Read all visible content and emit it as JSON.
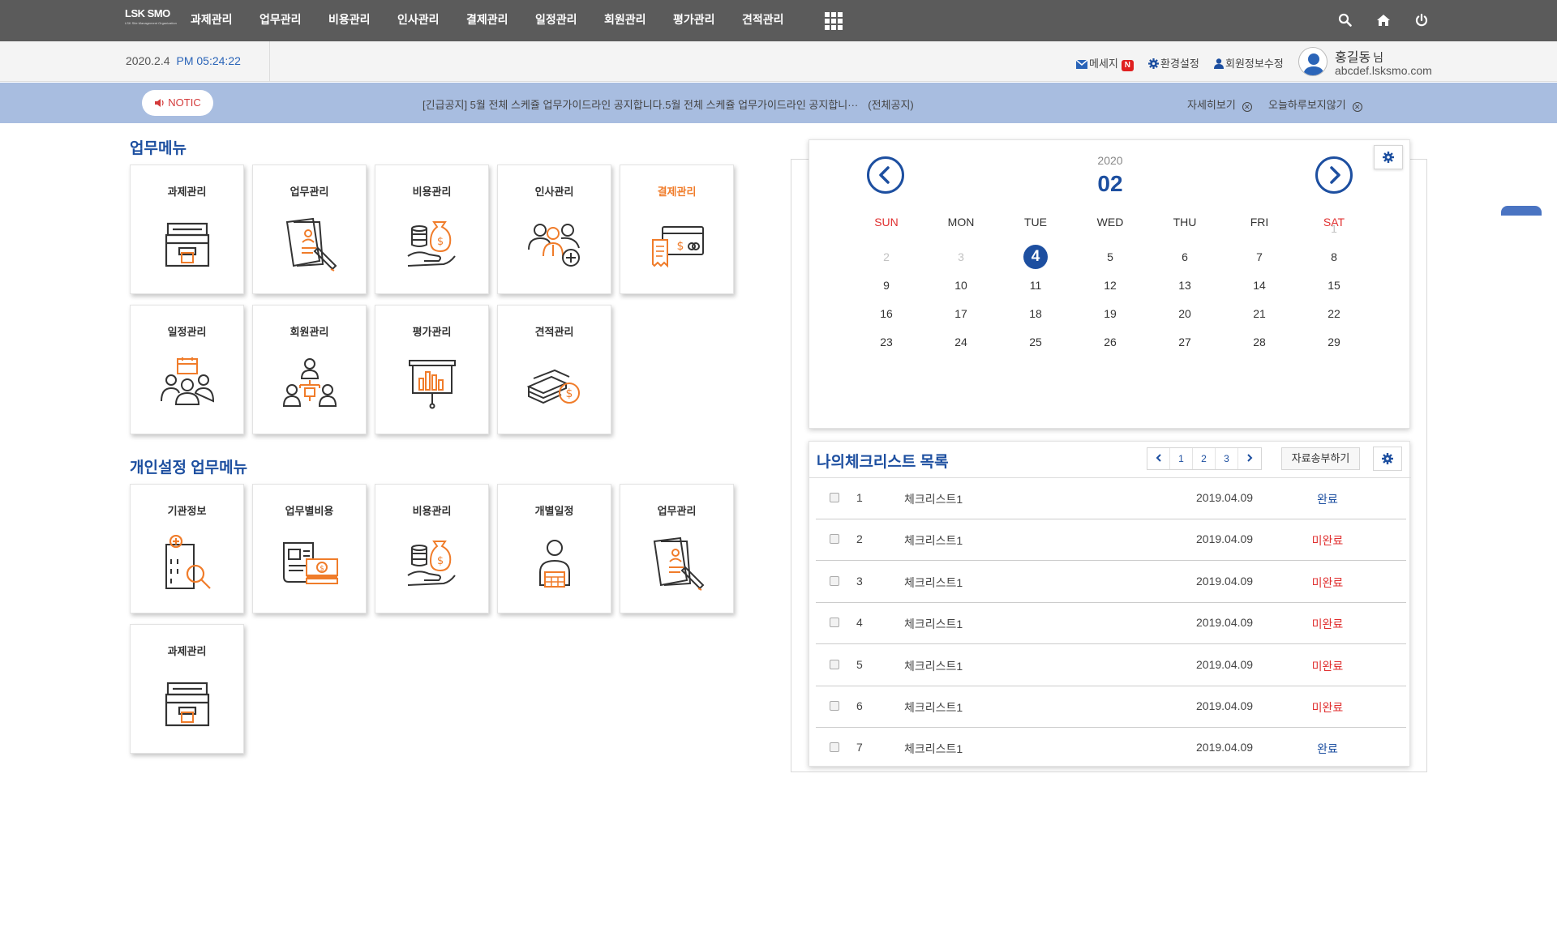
{
  "logo": {
    "text": "LSK SMO",
    "sub": "LSK Site Management Organization"
  },
  "nav": {
    "items": [
      "과제관리",
      "업무관리",
      "비용관리",
      "인사관리",
      "결제관리",
      "일정관리",
      "회원관리",
      "평가관리",
      "견적관리"
    ],
    "icons": [
      "grid-menu-icon",
      "search-icon",
      "home-icon",
      "power-icon"
    ]
  },
  "info": {
    "date": "2020.2.4",
    "time": "PM 05:24:22",
    "message": "메세지",
    "badge": "N",
    "settings": "환경설정",
    "profile_edit": "회원정보수정",
    "user_name": "홍길동",
    "user_suffix": "님",
    "user_email": "abcdef.lsksmo.com"
  },
  "notice": {
    "label": "NOTIC",
    "text": "[긴급공지]  5월 전체 스케쥴 업무가이드라인 공지합니다.5월 전체 스케쥴 업무가이드라인 공지합니···",
    "all": "(전체공지)",
    "detail": "자세히보기",
    "hide_today": "오늘하루보지않기"
  },
  "work_menu": {
    "title": "업무메뉴",
    "tiles": [
      "과제관리",
      "업무관리",
      "비용관리",
      "인사관리",
      "결제관리",
      "일정관리",
      "회원관리",
      "평가관리",
      "견적관리"
    ],
    "highlight": "결제관리"
  },
  "personal_menu": {
    "title": "개인설정 업무메뉴",
    "tiles": [
      "기관정보",
      "업무별비용",
      "비용관리",
      "개별일정",
      "업무관리",
      "과제관리"
    ]
  },
  "calendar": {
    "year": "2020",
    "month": "02",
    "weekdays": [
      "SUN",
      "MON",
      "TUE",
      "WED",
      "THU",
      "FRI",
      "SAT"
    ],
    "rows": [
      [
        "",
        "",
        "",
        "",
        "",
        "",
        "1"
      ],
      [
        "2",
        "3",
        "4",
        "5",
        "6",
        "7",
        "8"
      ],
      [
        "9",
        "10",
        "11",
        "12",
        "13",
        "14",
        "15"
      ],
      [
        "16",
        "17",
        "18",
        "19",
        "20",
        "21",
        "22"
      ],
      [
        "23",
        "24",
        "25",
        "26",
        "27",
        "28",
        "29"
      ]
    ],
    "muted_days": [
      "1",
      "2",
      "3"
    ],
    "today": "4"
  },
  "checklist": {
    "title": "나의체크리스트 목록",
    "pages": [
      "1",
      "2",
      "3"
    ],
    "upload_label": "자료송부하기",
    "rows": [
      {
        "no": "1",
        "name": "체크리스트1",
        "date": "2019.04.09",
        "status": "완료"
      },
      {
        "no": "2",
        "name": "체크리스트1",
        "date": "2019.04.09",
        "status": "미완료"
      },
      {
        "no": "3",
        "name": "체크리스트1",
        "date": "2019.04.09",
        "status": "미완료"
      },
      {
        "no": "4",
        "name": "체크리스트1",
        "date": "2019.04.09",
        "status": "미완료"
      },
      {
        "no": "5",
        "name": "체크리스트1",
        "date": "2019.04.09",
        "status": "미완료"
      },
      {
        "no": "6",
        "name": "체크리스트1",
        "date": "2019.04.09",
        "status": "미완료"
      },
      {
        "no": "7",
        "name": "체크리스트1",
        "date": "2019.04.09",
        "status": "완료"
      }
    ]
  },
  "colors": {
    "brand": "#1d4fa0",
    "accent": "#f07c2a",
    "done": "#1d4fa0",
    "not_done": "#e03030",
    "topnav": "#5b5b5b",
    "notice_bar": "#a8bde0"
  }
}
